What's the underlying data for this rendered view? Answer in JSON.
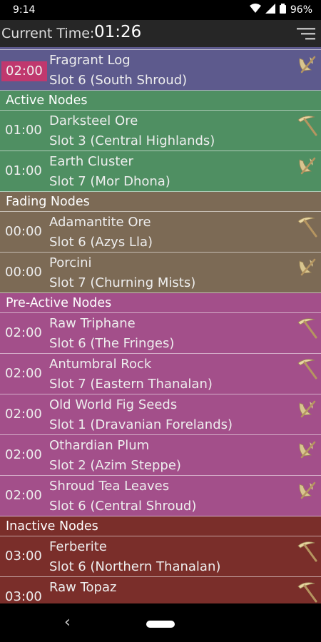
{
  "status_bar": {
    "time": "9:14",
    "battery": "96%"
  },
  "header": {
    "current_time_label": "Current Time:",
    "current_time_value": "01:26"
  },
  "colors": {
    "top_partial": "#5d5a8d",
    "active": "#4f8f62",
    "fading": "#7c6a55",
    "pre_active": "#a34f8a",
    "inactive": "#7a2e2a",
    "highlight_time": "#c0386e"
  },
  "list": {
    "top_partial": [
      {
        "time": "02:00",
        "name": "Fragrant Log",
        "slot": "Slot 6 (South Shroud)",
        "icon": "hatchet-icon"
      }
    ],
    "active": {
      "title": "Active Nodes",
      "items": [
        {
          "time": "01:00",
          "name": "Darksteel Ore",
          "slot": "Slot 3 (Central Highlands)",
          "icon": "pickaxe-icon"
        },
        {
          "time": "01:00",
          "name": "Earth Cluster",
          "slot": "Slot 7 (Mor Dhona)",
          "icon": "hatchet-icon"
        }
      ]
    },
    "fading": {
      "title": "Fading Nodes",
      "items": [
        {
          "time": "00:00",
          "name": "Adamantite Ore",
          "slot": "Slot 6 (Azys Lla)",
          "icon": "pickaxe-icon"
        },
        {
          "time": "00:00",
          "name": "Porcini",
          "slot": "Slot 7 (Churning Mists)",
          "icon": "hatchet-icon"
        }
      ]
    },
    "pre_active": {
      "title": "Pre-Active Nodes",
      "items": [
        {
          "time": "02:00",
          "name": "Raw Triphane",
          "slot": "Slot 6 (The Fringes)",
          "icon": "pickaxe-icon"
        },
        {
          "time": "02:00",
          "name": "Antumbral Rock",
          "slot": "Slot 7 (Eastern Thanalan)",
          "icon": "pickaxe-icon"
        },
        {
          "time": "02:00",
          "name": "Old World Fig Seeds",
          "slot": "Slot 1 (Dravanian Forelands)",
          "icon": "hatchet-icon"
        },
        {
          "time": "02:00",
          "name": "Othardian Plum",
          "slot": "Slot 2 (Azim Steppe)",
          "icon": "hatchet-icon"
        },
        {
          "time": "02:00",
          "name": "Shroud Tea Leaves",
          "slot": "Slot 6 (Central Shroud)",
          "icon": "hatchet-icon"
        }
      ]
    },
    "inactive": {
      "title": "Inactive Nodes",
      "items": [
        {
          "time": "03:00",
          "name": "Ferberite",
          "slot": "Slot 6 (Northern Thanalan)",
          "icon": "pickaxe-icon"
        },
        {
          "time": "03:00",
          "name": "Raw Topaz",
          "slot": "",
          "icon": "pickaxe-icon"
        }
      ]
    }
  },
  "nav": {
    "back_icon": "back-icon",
    "home_icon": "home-pill-icon"
  }
}
